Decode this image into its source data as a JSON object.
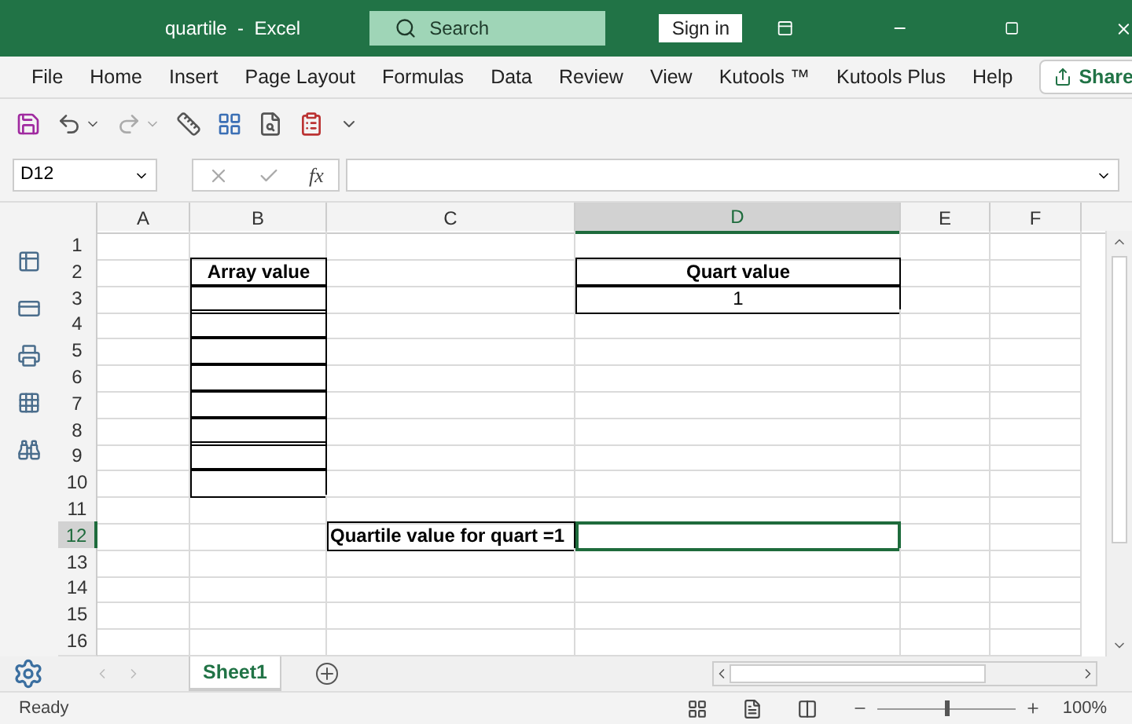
{
  "window": {
    "title": "quartile  -  Excel",
    "search": {
      "placeholder": "Search"
    },
    "sign_in": "Sign in"
  },
  "menu": [
    "File",
    "Home",
    "Insert",
    "Page Layout",
    "Formulas",
    "Data",
    "Review",
    "View",
    "Kutools ™",
    "Kutools Plus",
    "Help"
  ],
  "share": "Share",
  "formula_bar": {
    "name_box": "D12",
    "function_label": "fx"
  },
  "grid": {
    "columns": [
      {
        "label": "A",
        "selected": false
      },
      {
        "label": "B",
        "selected": false
      },
      {
        "label": "C",
        "selected": false
      },
      {
        "label": "D",
        "selected": true
      },
      {
        "label": "E",
        "selected": false
      },
      {
        "label": "F",
        "selected": false
      }
    ],
    "rows": [
      {
        "header": "1",
        "selected": false,
        "cells": [
          {
            "bordered": false,
            "selected": false
          },
          {
            "bordered": false,
            "selected": false
          },
          {
            "bordered": false,
            "selected": false
          },
          {
            "bordered": false,
            "selected": false
          },
          {
            "bordered": false,
            "selected": false
          },
          {
            "bordered": false,
            "selected": false
          }
        ]
      },
      {
        "header": "2",
        "selected": false,
        "cells": [
          {
            "bordered": false,
            "selected": false
          },
          {
            "text": "Array value",
            "bold": true,
            "bordered": true,
            "selected": false
          },
          {
            "bordered": false,
            "selected": false
          },
          {
            "text": "Quart value",
            "bold": true,
            "bordered": true,
            "selected": false
          },
          {
            "bordered": false,
            "selected": false
          },
          {
            "bordered": false,
            "selected": false
          }
        ]
      },
      {
        "header": "3",
        "selected": false,
        "cells": [
          {
            "bordered": false,
            "selected": false
          },
          {
            "bordered": true,
            "selected": false
          },
          {
            "bordered": false,
            "selected": false
          },
          {
            "text": "1",
            "bold": false,
            "bordered": true,
            "selected": false
          },
          {
            "bordered": false,
            "selected": false
          },
          {
            "bordered": false,
            "selected": false
          }
        ]
      },
      {
        "header": "4",
        "selected": false,
        "cells": [
          {
            "bordered": false,
            "selected": false
          },
          {
            "bordered": true,
            "selected": false
          },
          {
            "bordered": false,
            "selected": false
          },
          {
            "bordered": false,
            "selected": false
          },
          {
            "bordered": false,
            "selected": false
          },
          {
            "bordered": false,
            "selected": false
          }
        ]
      },
      {
        "header": "5",
        "selected": false,
        "cells": [
          {
            "bordered": false,
            "selected": false
          },
          {
            "bordered": true,
            "selected": false
          },
          {
            "bordered": false,
            "selected": false
          },
          {
            "bordered": false,
            "selected": false
          },
          {
            "bordered": false,
            "selected": false
          },
          {
            "bordered": false,
            "selected": false
          }
        ]
      },
      {
        "header": "6",
        "selected": false,
        "cells": [
          {
            "bordered": false,
            "selected": false
          },
          {
            "bordered": true,
            "selected": false
          },
          {
            "bordered": false,
            "selected": false
          },
          {
            "bordered": false,
            "selected": false
          },
          {
            "bordered": false,
            "selected": false
          },
          {
            "bordered": false,
            "selected": false
          }
        ]
      },
      {
        "header": "7",
        "selected": false,
        "cells": [
          {
            "bordered": false,
            "selected": false
          },
          {
            "bordered": true,
            "selected": false
          },
          {
            "bordered": false,
            "selected": false
          },
          {
            "bordered": false,
            "selected": false
          },
          {
            "bordered": false,
            "selected": false
          },
          {
            "bordered": false,
            "selected": false
          }
        ]
      },
      {
        "header": "8",
        "selected": false,
        "cells": [
          {
            "bordered": false,
            "selected": false
          },
          {
            "bordered": true,
            "selected": false
          },
          {
            "bordered": false,
            "selected": false
          },
          {
            "bordered": false,
            "selected": false
          },
          {
            "bordered": false,
            "selected": false
          },
          {
            "bordered": false,
            "selected": false
          }
        ]
      },
      {
        "header": "9",
        "selected": false,
        "cells": [
          {
            "bordered": false,
            "selected": false
          },
          {
            "bordered": true,
            "selected": false
          },
          {
            "bordered": false,
            "selected": false
          },
          {
            "bordered": false,
            "selected": false
          },
          {
            "bordered": false,
            "selected": false
          },
          {
            "bordered": false,
            "selected": false
          }
        ]
      },
      {
        "header": "10",
        "selected": false,
        "cells": [
          {
            "bordered": false,
            "selected": false
          },
          {
            "bordered": true,
            "selected": false
          },
          {
            "bordered": false,
            "selected": false
          },
          {
            "bordered": false,
            "selected": false
          },
          {
            "bordered": false,
            "selected": false
          },
          {
            "bordered": false,
            "selected": false
          }
        ]
      },
      {
        "header": "11",
        "selected": false,
        "cells": [
          {
            "bordered": false,
            "selected": false
          },
          {
            "bordered": false,
            "selected": false
          },
          {
            "bordered": false,
            "selected": false
          },
          {
            "bordered": false,
            "selected": false
          },
          {
            "bordered": false,
            "selected": false
          },
          {
            "bordered": false,
            "selected": false
          }
        ]
      },
      {
        "header": "12",
        "selected": true,
        "cells": [
          {
            "bordered": false,
            "selected": false
          },
          {
            "bordered": false,
            "selected": false
          },
          {
            "text": "Quartile value for quart =1",
            "bold": true,
            "bordered": true,
            "selected": false
          },
          {
            "bordered": false,
            "selected": true
          },
          {
            "bordered": false,
            "selected": false
          },
          {
            "bordered": false,
            "selected": false
          }
        ]
      },
      {
        "header": "13",
        "selected": false,
        "cells": [
          {
            "bordered": false,
            "selected": false
          },
          {
            "bordered": false,
            "selected": false
          },
          {
            "bordered": false,
            "selected": false
          },
          {
            "bordered": false,
            "selected": false
          },
          {
            "bordered": false,
            "selected": false
          },
          {
            "bordered": false,
            "selected": false
          }
        ]
      },
      {
        "header": "14",
        "selected": false,
        "cells": [
          {
            "bordered": false,
            "selected": false
          },
          {
            "bordered": false,
            "selected": false
          },
          {
            "bordered": false,
            "selected": false
          },
          {
            "bordered": false,
            "selected": false
          },
          {
            "bordered": false,
            "selected": false
          },
          {
            "bordered": false,
            "selected": false
          }
        ]
      },
      {
        "header": "15",
        "selected": false,
        "cells": [
          {
            "bordered": false,
            "selected": false
          },
          {
            "bordered": false,
            "selected": false
          },
          {
            "bordered": false,
            "selected": false
          },
          {
            "bordered": false,
            "selected": false
          },
          {
            "bordered": false,
            "selected": false
          },
          {
            "bordered": false,
            "selected": false
          }
        ]
      },
      {
        "header": "16",
        "selected": false,
        "cells": [
          {
            "bordered": false,
            "selected": false
          },
          {
            "bordered": false,
            "selected": false
          },
          {
            "bordered": false,
            "selected": false
          },
          {
            "bordered": false,
            "selected": false
          },
          {
            "bordered": false,
            "selected": false
          },
          {
            "bordered": false,
            "selected": false
          }
        ]
      }
    ]
  },
  "sheet_tabs": [
    {
      "label": "Sheet1",
      "selected": true
    }
  ],
  "status": {
    "text": "Ready",
    "zoom": "100%",
    "zoom_slider": {
      "level": 0.5
    }
  }
}
